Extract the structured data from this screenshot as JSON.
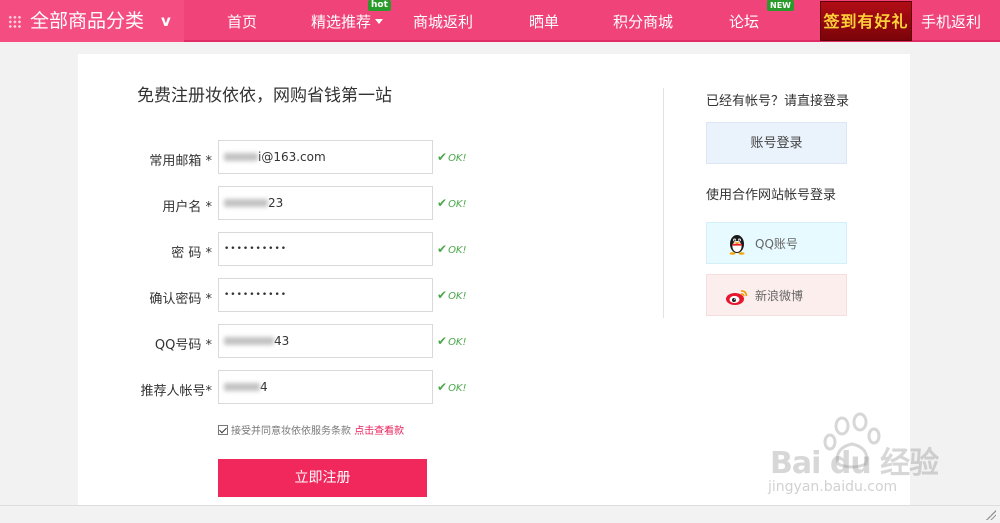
{
  "nav": {
    "all_categories": "全部商品分类",
    "all_categories_caret": "v",
    "items": [
      {
        "label": "首页"
      },
      {
        "label": "精选推荐",
        "badge": "hot"
      },
      {
        "label": "商城返利"
      },
      {
        "label": "晒单"
      },
      {
        "label": "积分商城"
      },
      {
        "label": "论坛",
        "badge": "NEW"
      },
      {
        "label": "手机返利"
      }
    ],
    "promo_text": "签到有好礼"
  },
  "form": {
    "title": "免费注册妆依依，网购省钱第一站",
    "fields": [
      {
        "label": "常用邮箱 *",
        "value": "i@163.com",
        "status": "OK!"
      },
      {
        "label": "用户名 *",
        "value": "23",
        "status": "OK!"
      },
      {
        "label": "密 码 *",
        "value": "••••••••••",
        "status": "OK!"
      },
      {
        "label": "确认密码 *",
        "value": "••••••••••",
        "status": "OK!"
      },
      {
        "label": "QQ号码 *",
        "value": "43",
        "status": "OK!"
      },
      {
        "label": "推荐人帐号*",
        "value": "4",
        "status": "OK!"
      }
    ],
    "agreement_text": "接受并同意妆依依服务条款",
    "agreement_link": "点击查看款",
    "submit_label": "立即注册"
  },
  "sidebar": {
    "have_account": "已经有帐号？请直接登录",
    "login_button": "账号登录",
    "partner_login": "使用合作网站帐号登录",
    "qq_button": "QQ账号",
    "weibo_button": "新浪微博"
  },
  "watermark": {
    "brand": "Bai du 经验",
    "url": "jingyan.baidu.com"
  },
  "colors": {
    "nav_bg": "#f0437a",
    "submit_bg": "#f0285c",
    "ok_green": "#4aa84a",
    "link_red": "#e8205a"
  }
}
